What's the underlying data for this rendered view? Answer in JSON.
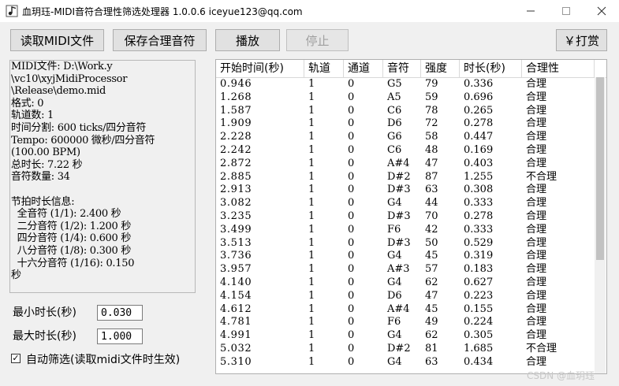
{
  "window": {
    "title": "血玥珏-MIDI音符合理性筛选处理器   1.0.0.6   iceyue123@qq.com"
  },
  "toolbar": {
    "load_midi": "读取MIDI文件",
    "save_notes": "保存合理音符",
    "play": "播放",
    "stop": "停止",
    "donate": "￥打赏"
  },
  "info": {
    "lines": [
      "MIDI文件: D:\\Work.y",
      "\\vc10\\xyjMidiProcessor",
      "\\Release\\demo.mid",
      "格式: 0",
      "轨道数: 1",
      "时间分割: 600 ticks/四分音符",
      "Tempo: 600000 微秒/四分音符",
      "(100.00 BPM)",
      "总时长: 7.22 秒",
      "音符数量: 34",
      "",
      "节拍时长信息:",
      "  全音符 (1/1): 2.400 秒",
      "  二分音符 (1/2): 1.200 秒",
      "  四分音符 (1/4): 0.600 秒",
      "  八分音符 (1/8): 0.300 秒",
      "  十六分音符 (1/16): 0.150",
      "秒"
    ]
  },
  "filters": {
    "min_label": "最小时长(秒)",
    "min_value": "0.030",
    "max_label": "最大时长(秒)",
    "max_value": "1.000",
    "auto_filter_label": "自动筛选(读取midi文件时生效)",
    "auto_filter_checked": true
  },
  "table": {
    "columns": [
      "开始时间(秒)",
      "轨道",
      "通道",
      "音符",
      "强度",
      "时长(秒)",
      "合理性"
    ],
    "rows": [
      [
        "0.946",
        "1",
        "0",
        "G5",
        "79",
        "0.336",
        "合理"
      ],
      [
        "1.268",
        "1",
        "0",
        "A5",
        "59",
        "0.696",
        "合理"
      ],
      [
        "1.587",
        "1",
        "0",
        "C6",
        "78",
        "0.265",
        "合理"
      ],
      [
        "1.909",
        "1",
        "0",
        "D6",
        "72",
        "0.278",
        "合理"
      ],
      [
        "2.228",
        "1",
        "0",
        "G6",
        "58",
        "0.447",
        "合理"
      ],
      [
        "2.242",
        "1",
        "0",
        "C6",
        "48",
        "0.169",
        "合理"
      ],
      [
        "2.872",
        "1",
        "0",
        "A#4",
        "47",
        "0.403",
        "合理"
      ],
      [
        "2.885",
        "1",
        "0",
        "D#2",
        "87",
        "1.255",
        "不合理"
      ],
      [
        "2.913",
        "1",
        "0",
        "D#3",
        "63",
        "0.308",
        "合理"
      ],
      [
        "3.082",
        "1",
        "0",
        "G4",
        "44",
        "0.333",
        "合理"
      ],
      [
        "3.235",
        "1",
        "0",
        "D#3",
        "70",
        "0.278",
        "合理"
      ],
      [
        "3.499",
        "1",
        "0",
        "F6",
        "42",
        "0.333",
        "合理"
      ],
      [
        "3.513",
        "1",
        "0",
        "D#3",
        "50",
        "0.529",
        "合理"
      ],
      [
        "3.736",
        "1",
        "0",
        "G4",
        "45",
        "0.319",
        "合理"
      ],
      [
        "3.957",
        "1",
        "0",
        "A#3",
        "57",
        "0.183",
        "合理"
      ],
      [
        "4.140",
        "1",
        "0",
        "G4",
        "62",
        "0.627",
        "合理"
      ],
      [
        "4.154",
        "1",
        "0",
        "D6",
        "47",
        "0.223",
        "合理"
      ],
      [
        "4.612",
        "1",
        "0",
        "A#4",
        "45",
        "0.155",
        "合理"
      ],
      [
        "4.781",
        "1",
        "0",
        "F6",
        "49",
        "0.224",
        "合理"
      ],
      [
        "4.991",
        "1",
        "0",
        "G4",
        "62",
        "0.305",
        "合理"
      ],
      [
        "5.032",
        "1",
        "0",
        "D#2",
        "81",
        "1.685",
        "不合理"
      ],
      [
        "5.310",
        "1",
        "0",
        "G4",
        "63",
        "0.434",
        "合理"
      ]
    ]
  },
  "watermark": "CSDN @血玥珏"
}
